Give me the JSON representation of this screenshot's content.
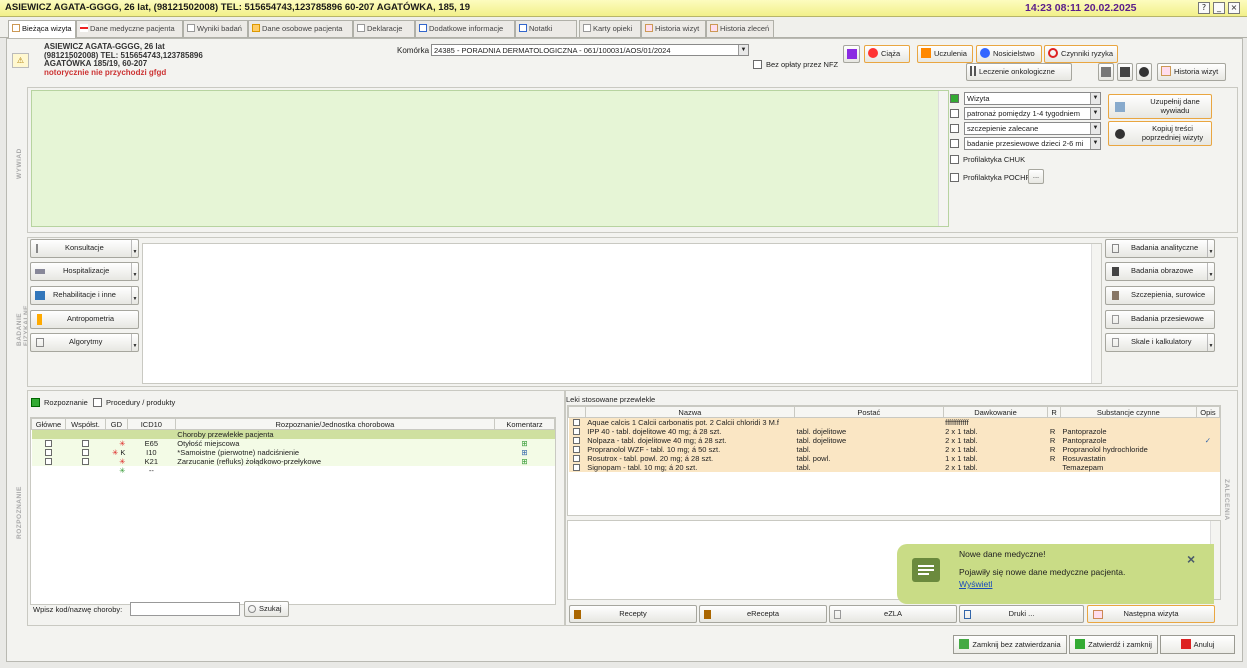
{
  "window": {
    "title": "ASIEWICZ AGATA-GGGG, 26 lat, (98121502008) TEL: 515654743,123785896 60-207 AGATÓWKA, 185, 19",
    "clock": "14:23  08:11 20.02.2025",
    "help": "?",
    "minimize": "_",
    "close": "×"
  },
  "tabs": [
    {
      "label": "Bieżąca wizyta"
    },
    {
      "label": "Dane medyczne pacjenta"
    },
    {
      "label": "Wyniki badań"
    },
    {
      "label": "Dane osobowe pacjenta"
    },
    {
      "label": "Deklaracje"
    },
    {
      "label": "Dodatkowe informacje"
    },
    {
      "label": "Notatki"
    },
    {
      "label": "Karty opieki"
    },
    {
      "label": "Historia wizyt"
    },
    {
      "label": "Historia zleceń"
    }
  ],
  "patient": {
    "line1": "ASIEWICZ AGATA-GGGG, 26 lat",
    "line2": "(98121502008) TEL: 515654743,123785896",
    "line3": "AGATÓWKA 185/19, 60-207",
    "line4": "notorycznie nie przychodzi gfgd"
  },
  "header": {
    "komorka_label": "Komórka",
    "komorka_value": "24385 - PORADNIA DERMATOLOGICZNA - 061/100031/AOS/01/2024",
    "no_nfz": "Bez opłaty przez NFZ",
    "ciaza": "Ciąża",
    "uczulenia": "Uczulenia",
    "nosicielstwo": "Nosicielstwo",
    "czynniki": "Czynniki ryzyka",
    "onko": "Leczenie onkologiczne",
    "historia": "Historia wizyt"
  },
  "wywiad": {
    "section_label": "WYWIAD",
    "wizyta": "Wizyta",
    "patronaz": "patronaż pomiędzy 1-4 tygodniem",
    "szczepienie": "szczepienie zalecane",
    "badanie": "badanie przesiewowe dzieci 2-6 mi",
    "chuk": "Profilaktyka CHUK",
    "pochp": "Profilaktyka POCHP",
    "more": "...",
    "uzupelnij": "Uzupełnij dane wywiadu",
    "kopiuj": "Kopiuj treści poprzedniej wizyty"
  },
  "badanie": {
    "section_label": "BADANIE FIZYKALNE",
    "left": [
      "Konsultacje",
      "Hospitalizacje",
      "Rehabilitacje i inne",
      "Antropometria",
      "Algorytmy"
    ],
    "right": [
      "Badania analityczne",
      "Badania obrazowe",
      "Szczepienia, surowice",
      "Badania przesiewowe",
      "Skale i kalkulatory"
    ]
  },
  "rozpoznanie": {
    "section_label": "ROZPOZNANIE",
    "tab1": "Rozpoznanie",
    "tab2": "Procedury / produkty",
    "cols": [
      "Główne",
      "Współst.",
      "GD",
      "ICD10",
      "Rozpoznanie/Jednostka chorobowa",
      "Komentarz"
    ],
    "group": "Choroby przewlekłe pacjenta",
    "rows": [
      {
        "gd": "",
        "icd": "E65",
        "name": "Otyłość miejscowa"
      },
      {
        "gd": "K",
        "icd": "I10",
        "name": "*Samoistne (pierwotne) nadciśnienie"
      },
      {
        "gd": "",
        "icd": "K21",
        "name": "Zarzucanie (refluks) żołądkowo-przełykowe"
      },
      {
        "gd": "",
        "icd": "--",
        "name": ""
      }
    ],
    "search_label": "Wpisz kod/nazwę choroby:",
    "search_btn": "Szukaj"
  },
  "leki": {
    "title": "Leki stosowane przewlekle",
    "section_label": "ZALECENIA",
    "cols": [
      "Nazwa",
      "Postać",
      "Dawkowanie",
      "R",
      "Substancje czynne",
      "Opis"
    ],
    "rows": [
      {
        "name": "Aquae calcis 1 Calcii carbonatis pot. 2 Calcii chloridi 3 M.f",
        "postac": "",
        "dawk": "ffffffffffff",
        "r": "",
        "subst": "",
        "opis": ""
      },
      {
        "name": "IPP 40 - tabl. dojelitowe 40 mg; á 28 szt.",
        "postac": "tabl. dojelitowe",
        "dawk": "2 x 1 tabl.",
        "r": "R",
        "subst": "Pantoprazole",
        "opis": ""
      },
      {
        "name": "Nolpaza - tabl. dojelitowe 40 mg; á 28 szt.",
        "postac": "tabl. dojelitowe",
        "dawk": "2 x 1 tabl.",
        "r": "R",
        "subst": "Pantoprazole",
        "opis": "✓"
      },
      {
        "name": "Propranolol WZF - tabl. 10 mg; á 50 szt.",
        "postac": "tabl.",
        "dawk": "2 x 1 tabl.",
        "r": "R",
        "subst": "Propranolol hydrochloride",
        "opis": ""
      },
      {
        "name": "Rosutrox - tabl. powl. 20 mg; á 28 szt.",
        "postac": "tabl. powl.",
        "dawk": "1 x 1 tabl.",
        "r": "R",
        "subst": "Rosuvastatin",
        "opis": ""
      },
      {
        "name": "Signopam - tabl. 10 mg; á 20 szt.",
        "postac": "tabl.",
        "dawk": "2 x 1 tabl.",
        "r": "",
        "subst": "Temazepam",
        "opis": ""
      }
    ],
    "recepty": "Recepty",
    "erecepta": "eRecepta",
    "ezla": "eZLA",
    "druki": "Druki ...",
    "nastepna": "Następna wizyta"
  },
  "toast": {
    "title": "Nowe dane medyczne!",
    "body": "Pojawiły się nowe dane medyczne pacjenta.",
    "link": "Wyświetl",
    "close": "×"
  },
  "footer": {
    "zamknij": "Zamknij bez zatwierdzania",
    "zatwierdz": "Zatwierdź i zamknij",
    "anuluj": "Anuluj"
  }
}
